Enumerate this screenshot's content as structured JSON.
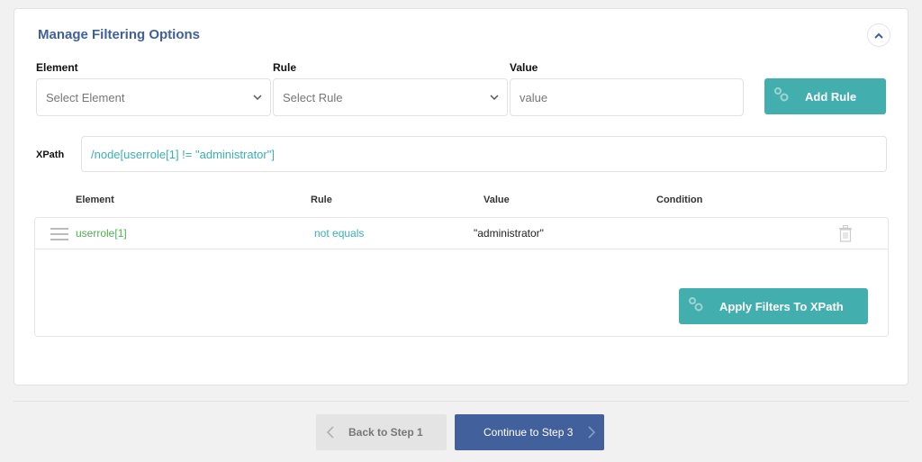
{
  "card": {
    "title": "Manage Filtering Options",
    "collapse_icon": "chevron-up-icon"
  },
  "form": {
    "element": {
      "label": "Element",
      "placeholder": "Select Element"
    },
    "rule": {
      "label": "Rule",
      "placeholder": "Select Rule"
    },
    "value": {
      "label": "Value",
      "placeholder": "value"
    },
    "add_rule_label": "Add Rule",
    "add_rule_icon": "gears-icon"
  },
  "xpath": {
    "label": "XPath",
    "value": "/node[userrole[1] != \"administrator\"]"
  },
  "table": {
    "headers": [
      "Element",
      "Rule",
      "Value",
      "Condition"
    ],
    "rows": [
      {
        "element": "userrole[1]",
        "rule": "not equals",
        "value": "\"administrator\"",
        "condition": ""
      }
    ]
  },
  "apply_button": {
    "label": "Apply Filters To XPath",
    "icon": "gears-icon"
  },
  "navigation": {
    "back_label": "Back to Step 1",
    "next_label": "Continue to Step 3"
  },
  "colors": {
    "teal": "#43aeae",
    "primary_blue": "#42619c",
    "title_blue": "#40609a",
    "element_green": "#4caf50"
  }
}
